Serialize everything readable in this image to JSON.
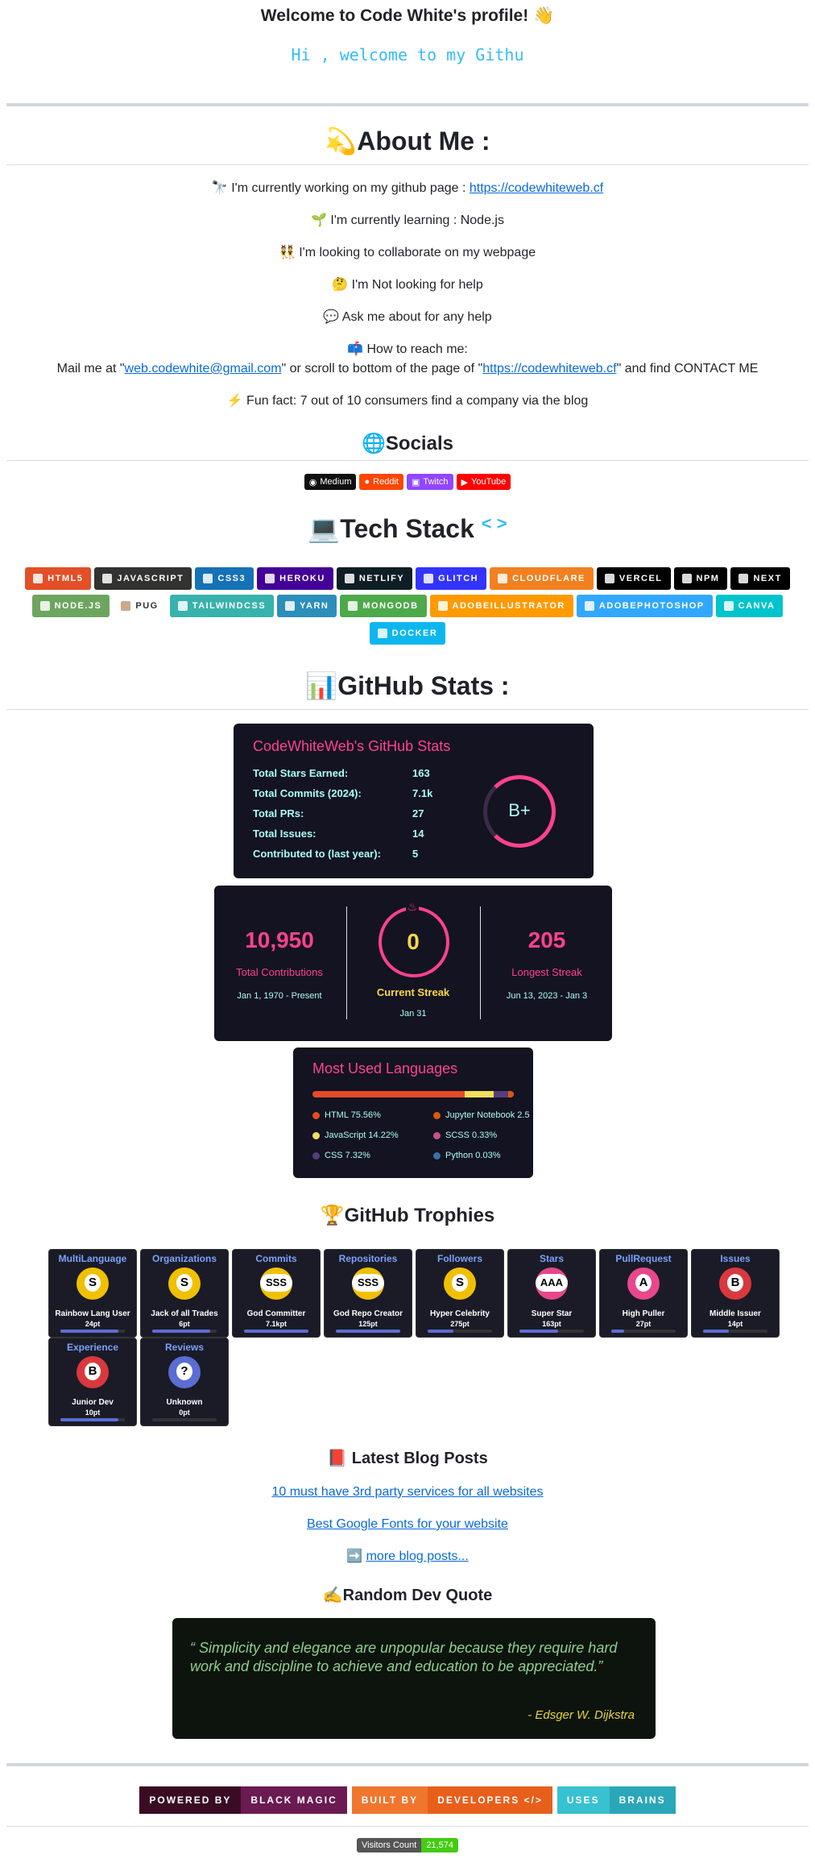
{
  "header": {
    "welcome": "Welcome to Code White's profile! 👋",
    "typing": "Hi , welcome to my Githu"
  },
  "about": {
    "title": "💫About Me :",
    "working_prefix": "🔭 I'm currently working on my github page : ",
    "working_link": "https://codewhiteweb.cf",
    "learning": "🌱 I'm currently learning : Node.js",
    "collaborate": "👯 I'm looking to collaborate on my webpage",
    "help": "🤔 I'm Not looking for help",
    "ask": "💬 Ask me about for any help",
    "reach": "📫 How to reach me:",
    "mail_prefix": "Mail me at \"",
    "mail_link": "web.codewhite@gmail.com",
    "mail_mid": "\" or scroll to bottom of the page of \"",
    "mail_link2": "https://codewhiteweb.cf",
    "mail_suffix": "\" and find CONTACT ME",
    "fun": "⚡ Fun fact: 7 out of 10 consumers find a company via the blog"
  },
  "socials": {
    "title": "🌐Socials",
    "items": [
      {
        "label": "Medium",
        "color": "#12100E",
        "icon": "medium-icon"
      },
      {
        "label": "Reddit",
        "color": "#FF4500",
        "icon": "reddit-icon"
      },
      {
        "label": "Twitch",
        "color": "#9146FF",
        "icon": "twitch-icon"
      },
      {
        "label": "YouTube",
        "color": "#FF0000",
        "icon": "youtube-icon"
      }
    ]
  },
  "tech": {
    "title": "💻Tech Stack",
    "code_symbol": "< >",
    "row1": [
      {
        "label": "HTML5",
        "color": "#E34F26"
      },
      {
        "label": "JAVASCRIPT",
        "color": "#323330"
      },
      {
        "label": "CSS3",
        "color": "#1572B6"
      },
      {
        "label": "HEROKU",
        "color": "#430098"
      },
      {
        "label": "NETLIFY",
        "color": "#0e1e25"
      },
      {
        "label": "GLITCH",
        "color": "#3333FF"
      },
      {
        "label": "CLOUDFLARE",
        "color": "#F38020"
      },
      {
        "label": "VERCEL",
        "color": "#000000"
      },
      {
        "label": "NPM",
        "color": "#000000"
      },
      {
        "label": "NEXT",
        "color": "#000000"
      }
    ],
    "row2": [
      {
        "label": "NODE.JS",
        "color": "#6DA55F"
      },
      {
        "label": "PUG",
        "color": "#ffffff"
      },
      {
        "label": "TAILWINDCSS",
        "color": "#38B2AC"
      },
      {
        "label": "YARN",
        "color": "#2C8EBB"
      },
      {
        "label": "MONGODB",
        "color": "#4ea94b"
      },
      {
        "label": "ADOBEILLUSTRATOR",
        "color": "#FF9A00"
      },
      {
        "label": "ADOBEPHOTOSHOP",
        "color": "#31A8FF"
      },
      {
        "label": "CANVA",
        "color": "#00C4CC"
      }
    ],
    "row3": [
      {
        "label": "DOCKER",
        "color": "#0db7ed"
      }
    ]
  },
  "stats": {
    "title": "📊GitHub Stats :",
    "card_title": "CodeWhiteWeb's GitHub Stats",
    "rows": [
      {
        "label": "Total Stars Earned:",
        "value": "163"
      },
      {
        "label": "Total Commits (2024):",
        "value": "7.1k"
      },
      {
        "label": "Total PRs:",
        "value": "27"
      },
      {
        "label": "Total Issues:",
        "value": "14"
      },
      {
        "label": "Contributed to (last year):",
        "value": "5"
      }
    ],
    "grade": "B+",
    "streak": {
      "total": "10,950",
      "total_label": "Total Contributions",
      "total_range": "Jan 1, 1970 - Present",
      "current": "0",
      "current_label": "Current Streak",
      "current_date": "Jan 31",
      "longest": "205",
      "longest_label": "Longest Streak",
      "longest_range": "Jun 13, 2023 - Jan 3"
    },
    "langs": {
      "title": "Most Used Languages",
      "items": [
        {
          "label": "HTML 75.56%",
          "color": "#e34c26",
          "pct": 75.56
        },
        {
          "label": "Jupyter Notebook 2.5",
          "color": "#DA5B0B",
          "pct": 2.5
        },
        {
          "label": "JavaScript 14.22%",
          "color": "#f1e05a",
          "pct": 14.22
        },
        {
          "label": "SCSS 0.33%",
          "color": "#c6538c",
          "pct": 0.33
        },
        {
          "label": "CSS 7.32%",
          "color": "#563d7c",
          "pct": 7.32
        },
        {
          "label": "Python 0.03%",
          "color": "#3572A5",
          "pct": 0.03
        }
      ]
    }
  },
  "trophies": {
    "title": "🏆GitHub Trophies",
    "items": [
      {
        "title": "MultiLanguage",
        "rank": "S",
        "name": "Rainbow Lang User",
        "pt": "24pt",
        "cup": "#f0c000",
        "fill": 0.9
      },
      {
        "title": "Organizations",
        "rank": "S",
        "name": "Jack of all Trades",
        "pt": "6pt",
        "cup": "#f0c000",
        "fill": 0.9
      },
      {
        "title": "Commits",
        "rank": "SSS",
        "name": "God Committer",
        "pt": "7.1kpt",
        "cup": "#f0c000",
        "fill": 1.0
      },
      {
        "title": "Repositories",
        "rank": "SSS",
        "name": "God Repo Creator",
        "pt": "125pt",
        "cup": "#f0c000",
        "fill": 1.0
      },
      {
        "title": "Followers",
        "rank": "S",
        "name": "Hyper Celebrity",
        "pt": "275pt",
        "cup": "#f0c000",
        "fill": 0.4
      },
      {
        "title": "Stars",
        "rank": "AAA",
        "name": "Super Star",
        "pt": "163pt",
        "cup": "#e8478b",
        "fill": 0.6
      },
      {
        "title": "PullRequest",
        "rank": "A",
        "name": "High Puller",
        "pt": "27pt",
        "cup": "#e8478b",
        "fill": 0.2
      },
      {
        "title": "Issues",
        "rank": "B",
        "name": "Middle Issuer",
        "pt": "14pt",
        "cup": "#d9383e",
        "fill": 0.4
      },
      {
        "title": "Experience",
        "rank": "B",
        "name": "Junior Dev",
        "pt": "10pt",
        "cup": "#d9383e",
        "fill": 0.9
      },
      {
        "title": "Reviews",
        "rank": "?",
        "name": "Unknown",
        "pt": "0pt",
        "cup": "#5b6cd3",
        "fill": 0.0
      }
    ]
  },
  "blog": {
    "title": "📕 Latest Blog Posts",
    "posts": [
      "10 must have 3rd party services for all websites",
      "Best Google Fonts for your website"
    ],
    "more_prefix": "➡️ ",
    "more": "more blog posts..."
  },
  "quote": {
    "title": "✍️Random Dev Quote",
    "open": "“",
    "text": " Simplicity and elegance are unpopular because they require hard work and discipline to achieve and education to be appreciated.",
    "close": "”",
    "author": "- Edsger W. Dijkstra"
  },
  "footer": {
    "b1_left": "POWERED BY",
    "b1_right": "BLACK MAGIC",
    "b2_left": "BUILT BY",
    "b2_right": "DEVELOPERS </>",
    "b3_left": "USES",
    "b3_right": "BRAINS",
    "visitors_label": "Visitors Count",
    "visitors_value": "21,574"
  }
}
